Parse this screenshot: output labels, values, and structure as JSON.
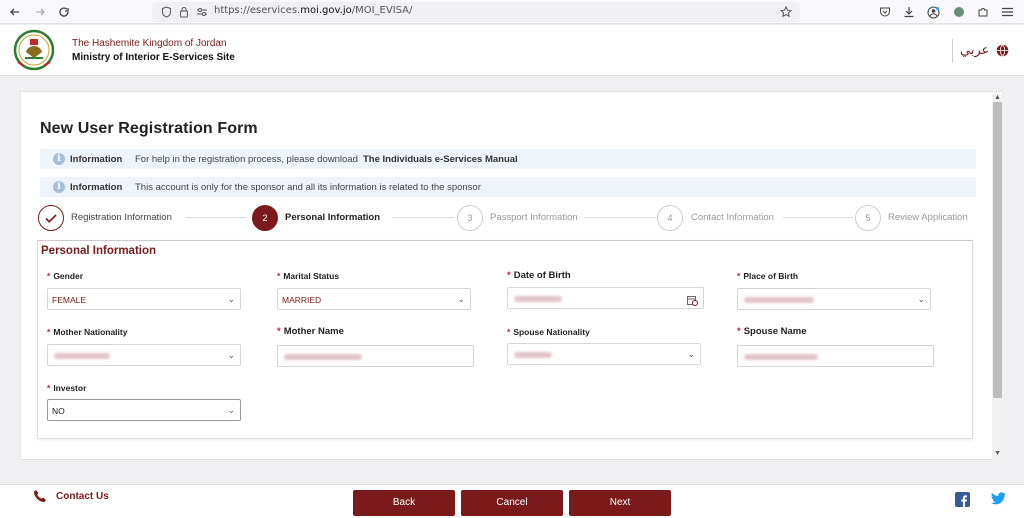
{
  "browser": {
    "url_prefix": "https://eservices.",
    "url_domain": "moi.gov.jo",
    "url_path": "/MOI_EVISA/"
  },
  "header": {
    "kingdom": "The Hashemite Kingdom of Jordan",
    "ministry": "Ministry of Interior E-Services Site",
    "language": "عربي"
  },
  "form": {
    "title": "New User Registration Form",
    "info_bars": [
      {
        "label": "Information",
        "text": "For help in the registration process, please download",
        "link": "The Individuals e-Services Manual"
      },
      {
        "label": "Information",
        "text": "This account is only for the sponsor and all its information is related to the sponsor"
      }
    ],
    "steps": [
      {
        "number": "",
        "label": "Registration Information",
        "state": "done"
      },
      {
        "number": "2",
        "label": "Personal Information",
        "state": "active"
      },
      {
        "number": "3",
        "label": "Passport Information",
        "state": "pending"
      },
      {
        "number": "4",
        "label": "Contact Information",
        "state": "pending"
      },
      {
        "number": "5",
        "label": "Review Application",
        "state": "pending"
      }
    ],
    "section_title": "Personal Information",
    "required_mark": "*",
    "fields": {
      "gender": {
        "label": "Gender",
        "value": "FEMALE"
      },
      "marital_status": {
        "label": "Marital Status",
        "value": "MARRIED"
      },
      "date_of_birth": {
        "label": "Date of Birth",
        "value": ""
      },
      "place_of_birth": {
        "label": "Place of Birth",
        "value": ""
      },
      "mother_nationality": {
        "label": "Mother Nationality",
        "value": ""
      },
      "mother_name": {
        "label": "Mother Name",
        "value": ""
      },
      "spouse_nationality": {
        "label": "Spouse Nationality",
        "value": ""
      },
      "spouse_name": {
        "label": "Spouse Name",
        "value": ""
      },
      "investor": {
        "label": "Investor",
        "value": "NO"
      }
    }
  },
  "footer": {
    "contact": "Contact Us",
    "back": "Back",
    "cancel": "Cancel",
    "next": "Next"
  },
  "colors": {
    "brand": "#7b1a1a",
    "required": "#c0262d",
    "info_bg": "#eef4fa"
  }
}
